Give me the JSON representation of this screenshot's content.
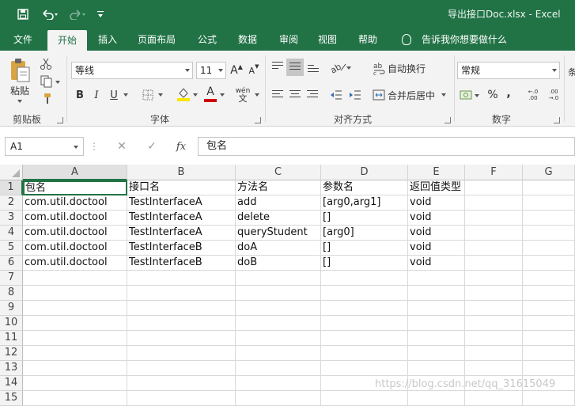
{
  "app": {
    "title": "导出接口Doc.xlsx  -  Excel",
    "qat": {
      "save_icon": "save-icon",
      "undo_icon": "undo-icon",
      "redo_icon": "redo-icon",
      "customize_icon": "customize-icon"
    }
  },
  "ribbon": {
    "tabs": [
      "文件",
      "开始",
      "插入",
      "页面布局",
      "公式",
      "数据",
      "审阅",
      "视图",
      "帮助"
    ],
    "active_tab": "开始",
    "tell_me": "告诉我你想要做什么",
    "clipboard": {
      "paste_label": "粘贴",
      "group_label": "剪贴板"
    },
    "font": {
      "font_name": "等线",
      "font_size": "11",
      "grow_label": "A",
      "shrink_label": "A",
      "bold": "B",
      "italic": "I",
      "underline": "U",
      "phonetic_top": "wén",
      "phonetic_bottom": "文",
      "color_letter": "A",
      "group_label": "字体"
    },
    "alignment": {
      "wrap_text": "自动换行",
      "merge_center": "合并后居中",
      "group_label": "对齐方式"
    },
    "number": {
      "format": "常规",
      "percent": "%",
      "comma": ",",
      "inc_decimal": "←.0 .00",
      "dec_decimal": ".00 →.0",
      "group_label": "数字"
    },
    "partial_group": "条"
  },
  "formula_bar": {
    "name_box": "A1",
    "fx_label": "fx",
    "cancel_symbol": "✕",
    "enter_symbol": "✓",
    "content": "包名"
  },
  "sheet": {
    "columns": [
      "A",
      "B",
      "C",
      "D",
      "E",
      "F",
      "G"
    ],
    "row_numbers": [
      "1",
      "2",
      "3",
      "4",
      "5",
      "6",
      "7",
      "8",
      "9",
      "10",
      "11",
      "12",
      "13",
      "14",
      "15"
    ],
    "rows": [
      [
        "包名",
        "接口名",
        "方法名",
        "参数名",
        "返回值类型",
        "",
        ""
      ],
      [
        "com.util.doctool",
        "TestInterfaceA",
        "add",
        "[arg0,arg1]",
        "void",
        "",
        ""
      ],
      [
        "com.util.doctool",
        "TestInterfaceA",
        "delete",
        "[]",
        "void",
        "",
        ""
      ],
      [
        "com.util.doctool",
        "TestInterfaceA",
        "queryStudent",
        "[arg0]",
        "void",
        "",
        ""
      ],
      [
        "com.util.doctool",
        "TestInterfaceB",
        "doA",
        "[]",
        "void",
        "",
        ""
      ],
      [
        "com.util.doctool",
        "TestInterfaceB",
        "doB",
        "[]",
        "void",
        "",
        ""
      ]
    ],
    "selected_cell": "A1"
  },
  "watermark": "https://blog.csdn.net/qq_31615049",
  "colors": {
    "brand": "#217346",
    "ribbon_bg": "#f3f3f3",
    "font_red": "#d00000",
    "highlight_yellow": "#ffe600"
  }
}
